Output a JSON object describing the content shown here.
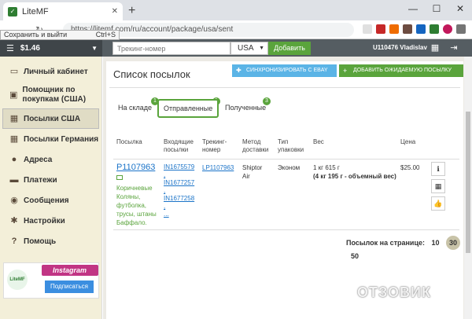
{
  "browser": {
    "tab_title": "LiteMF",
    "url": "https://litemf.com/ru/account/package/usa/sent",
    "tooltip_text": "Сохранить и выйти",
    "tooltip_shortcut": "Ctrl+S"
  },
  "header": {
    "balance": "$1.46",
    "tracking_placeholder": "Трекинг-номер",
    "country": "USA",
    "add_label": "Добавить",
    "user": "U110476 Vladislav"
  },
  "sidebar": {
    "items": [
      {
        "label": "Личный кабинет"
      },
      {
        "label": "Помощник по покупкам (США)"
      },
      {
        "label": "Посылки США"
      },
      {
        "label": "Посылки Германия"
      },
      {
        "label": "Адреса"
      },
      {
        "label": "Платежи"
      },
      {
        "label": "Сообщения"
      },
      {
        "label": "Настройки"
      },
      {
        "label": "Помощь"
      }
    ],
    "instagram_label": "Instagram",
    "subscribe_label": "Подписаться",
    "logo_text": "LiteMF"
  },
  "main": {
    "title": "Список посылок",
    "sync_label": "СИНХРОНИЗИРОВАТЬ С EBAY",
    "add_expected_label": "ДОБАВИТЬ ОЖИДАЕМУЮ ПОСЫЛКУ",
    "tabs": [
      {
        "label": "На складе",
        "badge": "1"
      },
      {
        "label": "Отправленные",
        "badge": "1"
      },
      {
        "label": "Полученные",
        "badge": "3"
      }
    ],
    "columns": {
      "pkg": "Посылка",
      "incoming": "Входящие посылки",
      "tracking": "Трекинг-номер",
      "method": "Метод доставки",
      "type": "Тип упаковки",
      "weight": "Вес",
      "price": "Цена"
    },
    "row": {
      "id": "P1107963",
      "desc": "Коричневые Коляны, футболка, трусы, штаны Баффало.",
      "incoming": [
        "IN1675579",
        "IN1677257",
        "IN1677258"
      ],
      "incoming_sep": ",",
      "incoming_more": "...",
      "tracking": "LP1107963",
      "method": "Shiptor Air",
      "type": "Эконом",
      "weight": "1 кг 615 г",
      "weight_vol": "(4 кг 195 г - объемный вес)",
      "price": "$25.00"
    },
    "pager": {
      "label": "Посылок на странице:",
      "options": [
        "10",
        "30",
        "50"
      ],
      "current": "30"
    }
  },
  "watermark": "ОТЗОВИК",
  "colors": {
    "accent_green": "#5aa43c",
    "link_blue": "#1a73c8",
    "sidebar_bg": "#f3efd9",
    "header_bg": "#555d62"
  }
}
